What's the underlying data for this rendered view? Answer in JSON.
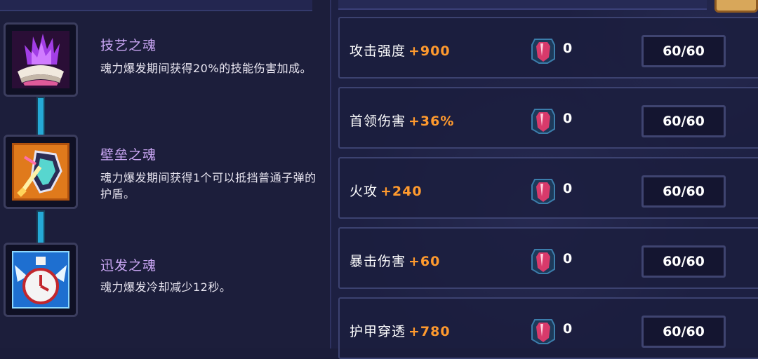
{
  "skills": [
    {
      "name": "技艺之魂",
      "description": "魂力爆发期间获得20%的技能伤害加成。",
      "icon": "purple-flame-book-icon"
    },
    {
      "name": "壁垒之魂",
      "description": "魂力爆发期间获得1个可以抵挡普通子弹的护盾。",
      "icon": "shield-sword-icon"
    },
    {
      "name": "迅发之魂",
      "description": "魂力爆发冷却减少12秒。",
      "icon": "winged-clock-icon"
    }
  ],
  "stats": [
    {
      "label": "攻击强度",
      "bonus": "+900",
      "gem_count": "0",
      "cap": "60/60"
    },
    {
      "label": "首领伤害",
      "bonus": "+36%",
      "gem_count": "0",
      "cap": "60/60"
    },
    {
      "label": "火攻",
      "bonus": "+240",
      "gem_count": "0",
      "cap": "60/60"
    },
    {
      "label": "暴击伤害",
      "bonus": "+60",
      "gem_count": "0",
      "cap": "60/60"
    },
    {
      "label": "护甲穿透",
      "bonus": "+780",
      "gem_count": "0",
      "cap": "60/60"
    }
  ],
  "icons": {
    "gem": "red-gem-icon"
  },
  "colors": {
    "bonus": "#ff9a2e",
    "skill_name": "#c9a6f3",
    "connector": "#25a9d6"
  }
}
